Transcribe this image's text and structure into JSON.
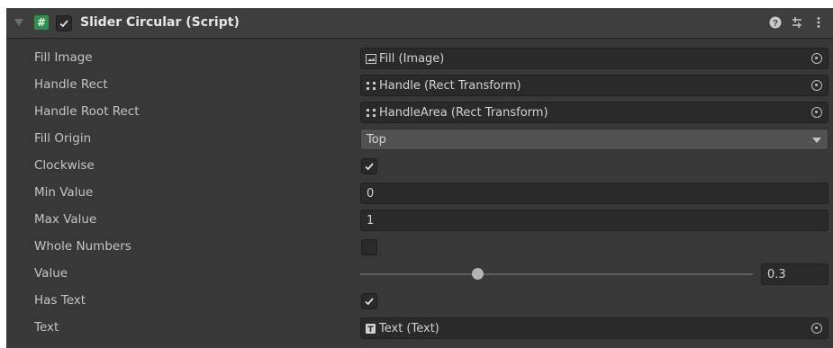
{
  "component": {
    "title": "Slider Circular (Script)",
    "script_icon_glyph": "#",
    "enabled": true,
    "icons": [
      "help-icon",
      "preset-icon",
      "kebab-menu-icon"
    ]
  },
  "fields": {
    "fill_image": {
      "label": "Fill Image",
      "value": "Fill (Image)",
      "icon": "image-icon"
    },
    "handle_rect": {
      "label": "Handle Rect",
      "value": "Handle (Rect Transform)",
      "icon": "rect-transform-icon"
    },
    "handle_root_rect": {
      "label": "Handle Root Rect",
      "value": "HandleArea (Rect Transform)",
      "icon": "rect-transform-icon"
    },
    "fill_origin": {
      "label": "Fill Origin",
      "value": "Top"
    },
    "clockwise": {
      "label": "Clockwise",
      "checked": true
    },
    "min_value": {
      "label": "Min Value",
      "value": "0"
    },
    "max_value": {
      "label": "Max Value",
      "value": "1"
    },
    "whole_numbers": {
      "label": "Whole Numbers",
      "checked": false
    },
    "value": {
      "label": "Value",
      "value": "0.3",
      "fraction": 0.3
    },
    "has_text": {
      "label": "Has Text",
      "checked": true
    },
    "text": {
      "label": "Text",
      "value": "Text (Text)",
      "icon": "text-icon"
    }
  },
  "colors": {
    "panel": "#383838",
    "header": "#3e3e3e",
    "field": "#2a2a2a",
    "script_icon": "#2f8f4e"
  }
}
